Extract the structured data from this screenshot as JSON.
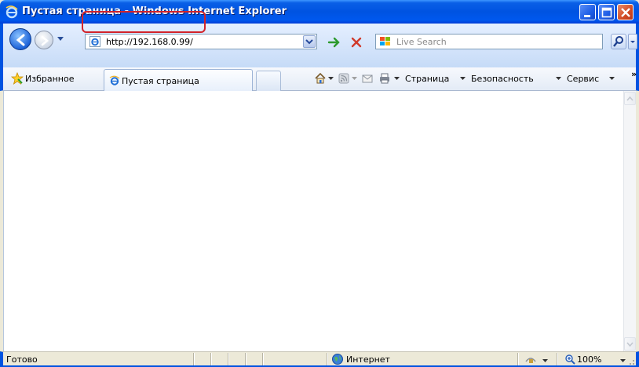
{
  "window": {
    "title": "Пустая страница - Windows Internet Explorer",
    "title_icon": "ie-icon",
    "buttons": [
      "minimize-icon",
      "maximize-icon",
      "close-icon"
    ]
  },
  "navbar": {
    "address": {
      "value": "http://192.168.0.99/",
      "icon": "ie-page-icon"
    },
    "search": {
      "placeholder": "Live Search",
      "icon": "live-search-logo"
    }
  },
  "commandbar": {
    "favorites_label": "Избранное",
    "tab_label": "Пустая страница",
    "page_label": "Страница",
    "security_label": "Безопасность",
    "tools_label": "Сервис",
    "more_label": "»"
  },
  "statusbar": {
    "status": "Готово",
    "zone": "Интернет",
    "zoom": "100%"
  },
  "colors": {
    "title_blue": "#0053e1",
    "highlight_red": "#d2232a",
    "go_green": "#2d9a2d",
    "stop_red": "#d03a2a"
  }
}
